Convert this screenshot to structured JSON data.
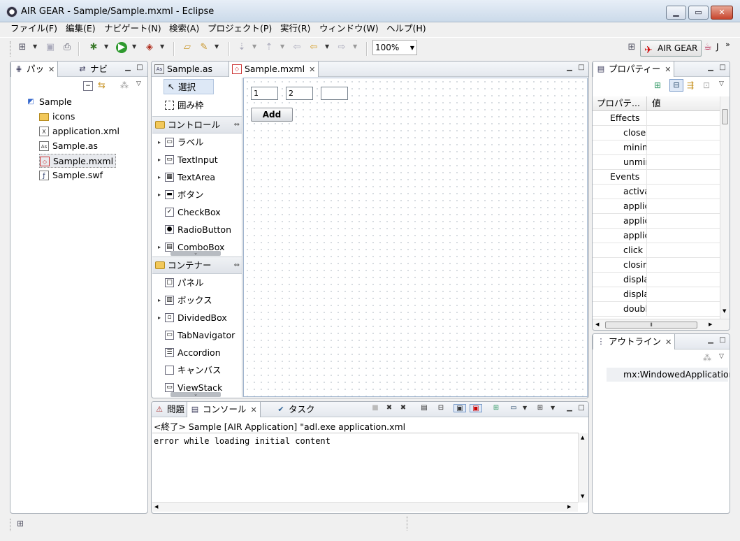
{
  "window": {
    "title": "AIR GEAR - Sample/Sample.mxml - Eclipse",
    "controls": [
      "minimize-icon",
      "maximize-icon",
      "close-icon"
    ]
  },
  "menu": {
    "items": [
      "ファイル(F)",
      "編集(E)",
      "ナビゲート(N)",
      "検索(A)",
      "プロジェクト(P)",
      "実行(R)",
      "ウィンドウ(W)",
      "ヘルプ(H)"
    ]
  },
  "toolbar": {
    "zoom": "100%",
    "perspective_label": "AIR GEAR",
    "perspective_overflow": "J",
    "more": "»"
  },
  "package_explorer": {
    "tabs": [
      {
        "label": "パッ",
        "icon": "package-explorer-icon",
        "close": "✕"
      },
      {
        "label": "ナビ",
        "icon": "navigator-icon",
        "close": ""
      }
    ],
    "tree": [
      {
        "label": "Sample",
        "icon": "project-icon",
        "level": 0
      },
      {
        "label": "icons",
        "icon": "folder-icon",
        "level": 1
      },
      {
        "label": "application.xml",
        "icon": "xml-file-icon",
        "level": 1
      },
      {
        "label": "Sample.as",
        "icon": "as-file-icon",
        "level": 1
      },
      {
        "label": "Sample.mxml",
        "icon": "mxml-file-icon",
        "level": 1,
        "selected": true
      },
      {
        "label": "Sample.swf",
        "icon": "swf-file-icon",
        "level": 1
      }
    ]
  },
  "editor": {
    "tabs": [
      {
        "label": "Sample.as",
        "icon": "as-file-icon"
      },
      {
        "label": "Sample.mxml",
        "icon": "mxml-file-icon",
        "active": true,
        "close": "✕"
      }
    ],
    "palette": {
      "tools": [
        {
          "label": "選択",
          "icon": "select-arrow-icon"
        },
        {
          "label": "囲み枠",
          "icon": "marquee-icon"
        }
      ],
      "drawers": [
        {
          "label": "コントロール",
          "items": [
            {
              "label": "ラベル",
              "icon": "label-icon",
              "expand": true
            },
            {
              "label": "TextInput",
              "icon": "textinput-icon",
              "expand": true
            },
            {
              "label": "TextArea",
              "icon": "textarea-icon",
              "expand": true
            },
            {
              "label": "ボタン",
              "icon": "button-icon",
              "expand": true
            },
            {
              "label": "CheckBox",
              "icon": "checkbox-icon",
              "expand": false
            },
            {
              "label": "RadioButton",
              "icon": "radiobutton-icon",
              "expand": false
            },
            {
              "label": "ComboBox",
              "icon": "combobox-icon",
              "expand": true
            }
          ]
        },
        {
          "label": "コンテナー",
          "items": [
            {
              "label": "パネル",
              "icon": "panel-icon",
              "expand": false
            },
            {
              "label": "ボックス",
              "icon": "box-icon",
              "expand": true
            },
            {
              "label": "DividedBox",
              "icon": "dividedbox-icon",
              "expand": true
            },
            {
              "label": "TabNavigator",
              "icon": "tabnavigator-icon",
              "expand": false
            },
            {
              "label": "Accordion",
              "icon": "accordion-icon",
              "expand": false
            },
            {
              "label": "キャンバス",
              "icon": "canvas-icon",
              "expand": false
            },
            {
              "label": "ViewStack",
              "icon": "viewstack-icon",
              "expand": false
            }
          ]
        }
      ]
    },
    "canvas": {
      "inputs": [
        "1",
        "2",
        ""
      ],
      "button_label": "Add"
    }
  },
  "console_view": {
    "tabs": [
      {
        "label": "問題",
        "icon": "problems-icon"
      },
      {
        "label": "コンソール",
        "icon": "console-icon",
        "active": true,
        "close": "✕"
      },
      {
        "label": "タスク",
        "icon": "tasks-icon"
      }
    ],
    "description": "<終了> Sample [AIR Application] \"adl.exe application.xml",
    "output": "error while loading initial content"
  },
  "properties": {
    "tab": {
      "label": "プロパティー",
      "icon": "properties-icon",
      "close": "✕"
    },
    "columns": [
      "プロパテ...",
      "値"
    ],
    "rows": [
      {
        "name": "Effects",
        "category": true
      },
      {
        "name": "closeE",
        "category": false
      },
      {
        "name": "minim",
        "category": false
      },
      {
        "name": "unmin",
        "category": false
      },
      {
        "name": "Events",
        "category": true
      },
      {
        "name": "activa",
        "category": false
      },
      {
        "name": "applic",
        "category": false
      },
      {
        "name": "applic",
        "category": false
      },
      {
        "name": "applic",
        "category": false
      },
      {
        "name": "click",
        "category": false
      },
      {
        "name": "closin",
        "category": false
      },
      {
        "name": "displa",
        "category": false
      },
      {
        "name": "displa",
        "category": false
      },
      {
        "name": "double",
        "category": false
      }
    ]
  },
  "outline": {
    "tab": {
      "label": "アウトライン",
      "icon": "outline-icon",
      "close": "✕"
    },
    "root": "mx:WindowedApplication"
  }
}
